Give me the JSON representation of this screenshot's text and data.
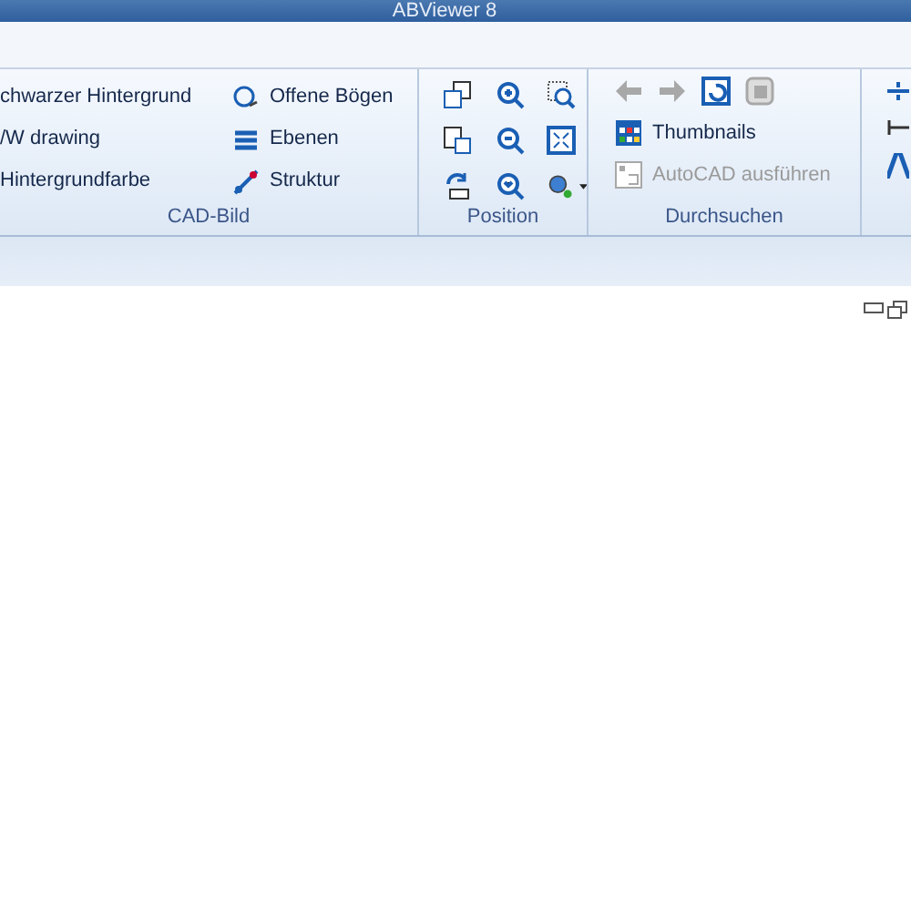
{
  "window": {
    "title": "ABViewer 8"
  },
  "ribbon": {
    "groups": [
      {
        "label": "CAD-Bild",
        "columns": [
          [
            {
              "label": "chwarzer Hintergrund"
            },
            {
              "label": "/W drawing"
            },
            {
              "label": "Hintergrundfarbe"
            }
          ],
          [
            {
              "label": "Offene Bögen"
            },
            {
              "label": "Ebenen"
            },
            {
              "label": "Struktur"
            }
          ]
        ]
      },
      {
        "label": "Position"
      },
      {
        "label": "Durchsuchen",
        "nav": [
          {
            "disabled": true
          },
          {
            "disabled": true
          },
          {
            "disabled": false
          },
          {
            "disabled": true
          }
        ],
        "buttons": [
          {
            "label": "Thumbnails",
            "disabled": false
          },
          {
            "label": "AutoCAD ausführen",
            "disabled": true
          }
        ]
      }
    ]
  }
}
